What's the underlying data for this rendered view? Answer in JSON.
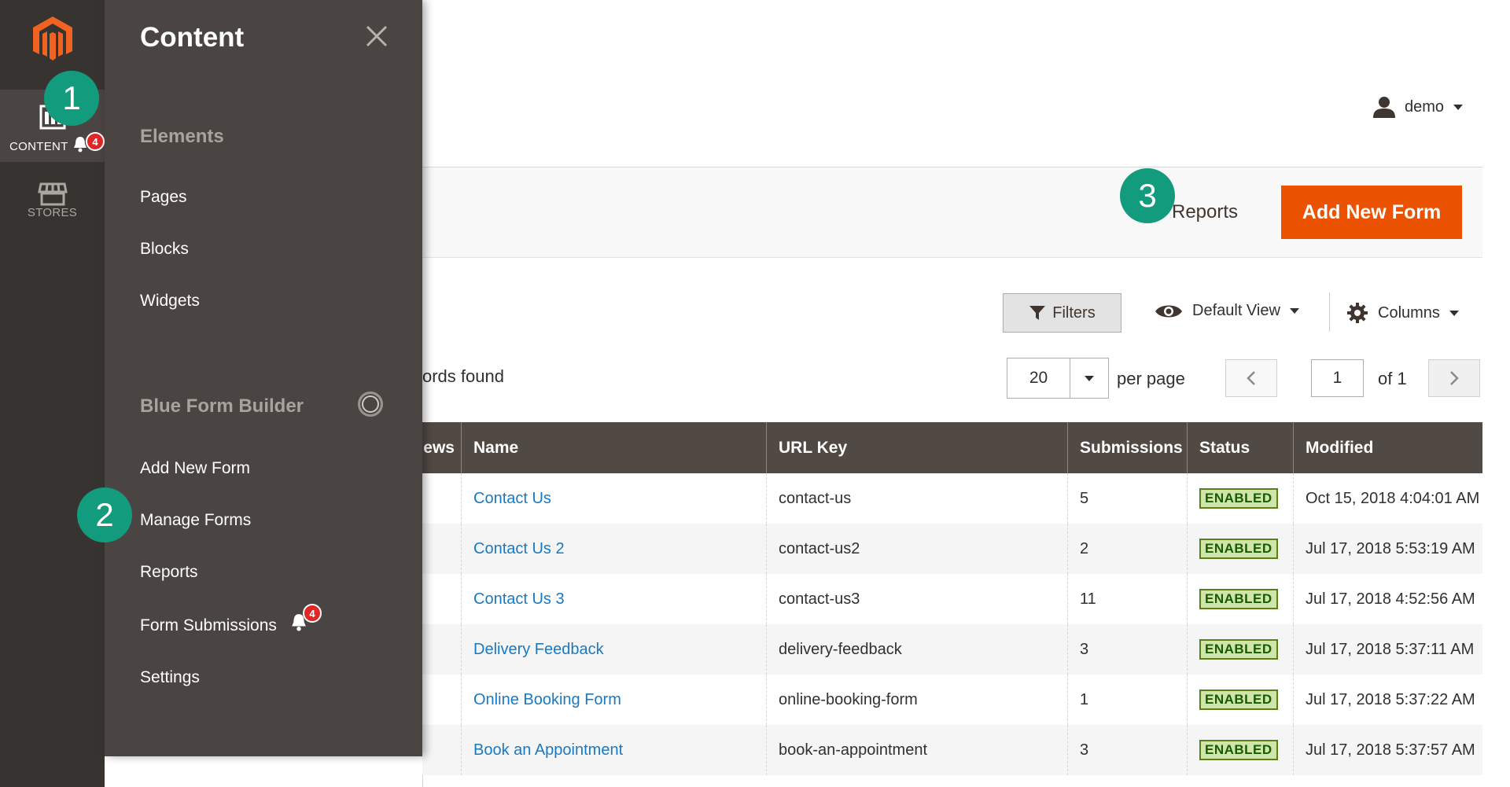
{
  "sidebar": {
    "logo": "magento-logo",
    "items": [
      {
        "label": "CONTENT",
        "icon": "content-icon",
        "badge": "4"
      },
      {
        "label": "STORES",
        "icon": "store-icon"
      }
    ]
  },
  "flyout": {
    "title": "Content",
    "sections": [
      {
        "title": "Elements",
        "links": [
          "Pages",
          "Blocks",
          "Widgets"
        ]
      },
      {
        "title": "Blue Form Builder",
        "links": [
          "Add New Form",
          "Manage Forms",
          "Reports",
          "Form Submissions",
          "Settings"
        ]
      }
    ],
    "form_submissions_badge": "4"
  },
  "steps": [
    "1",
    "2",
    "3"
  ],
  "header": {
    "user": "demo"
  },
  "actions": {
    "reports_label": "Reports",
    "add_new_form_label": "Add New Form"
  },
  "toolbar": {
    "filters_label": "Filters",
    "view_label": "Default View",
    "columns_label": "Columns",
    "records_found": "ords found",
    "per_page_value": "20",
    "per_page_label": "per page",
    "page_value": "1",
    "page_of": "of 1"
  },
  "grid": {
    "columns": [
      "ews",
      "Name",
      "URL Key",
      "Submissions",
      "Status",
      "Modified"
    ],
    "rows": [
      {
        "name": "Contact Us",
        "url_key": "contact-us",
        "submissions": "5",
        "status": "ENABLED",
        "modified": "Oct 15, 2018 4:04:01 AM"
      },
      {
        "name": "Contact Us 2",
        "url_key": "contact-us2",
        "submissions": "2",
        "status": "ENABLED",
        "modified": "Jul 17, 2018 5:53:19 AM"
      },
      {
        "name": "Contact Us 3",
        "url_key": "contact-us3",
        "submissions": "11",
        "status": "ENABLED",
        "modified": "Jul 17, 2018 4:52:56 AM"
      },
      {
        "name": "Delivery Feedback",
        "url_key": "delivery-feedback",
        "submissions": "3",
        "status": "ENABLED",
        "modified": "Jul 17, 2018 5:37:11 AM"
      },
      {
        "name": "Online Booking Form",
        "url_key": "online-booking-form",
        "submissions": "1",
        "status": "ENABLED",
        "modified": "Jul 17, 2018 5:37:22 AM"
      },
      {
        "name": "Book an Appointment",
        "url_key": "book-an-appointment",
        "submissions": "3",
        "status": "ENABLED",
        "modified": "Jul 17, 2018 5:37:57 AM"
      }
    ]
  },
  "colors": {
    "sidebar_bg": "#373330",
    "flyout_bg": "#4a4542",
    "accent": "#eb5202",
    "step_marker": "#139b7d",
    "link": "#1979c3",
    "grid_header": "#514943"
  }
}
